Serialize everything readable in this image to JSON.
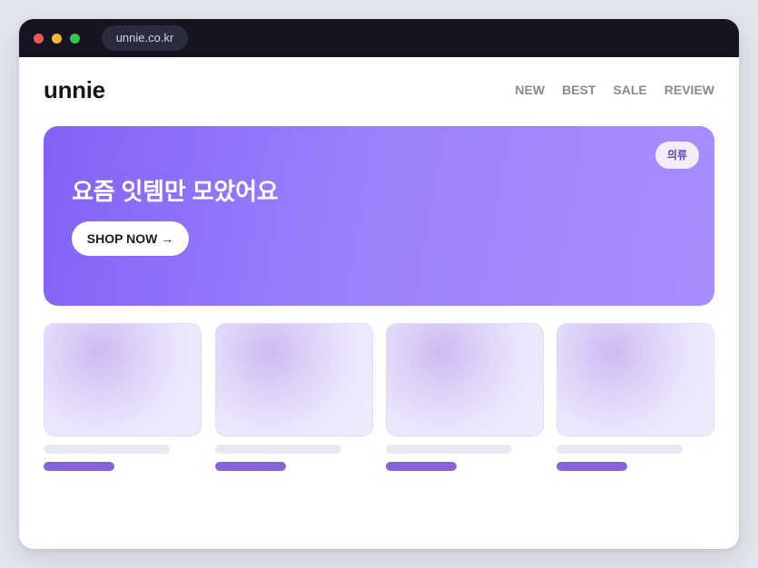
{
  "browser": {
    "url": "unnie.co.kr"
  },
  "site": {
    "logo": "unnie",
    "nav": [
      "NEW",
      "BEST",
      "SALE",
      "REVIEW"
    ]
  },
  "hero": {
    "badge": "의류",
    "title": "요즘 잇템만 모았어요",
    "cta": "SHOP NOW →"
  },
  "products": {
    "count": 4,
    "state": "loading-placeholder"
  },
  "colors": {
    "accent": "#8262f6",
    "accent_light": "#a98cfd",
    "price_placeholder": "#8565d6",
    "titlebar": "#141521"
  }
}
